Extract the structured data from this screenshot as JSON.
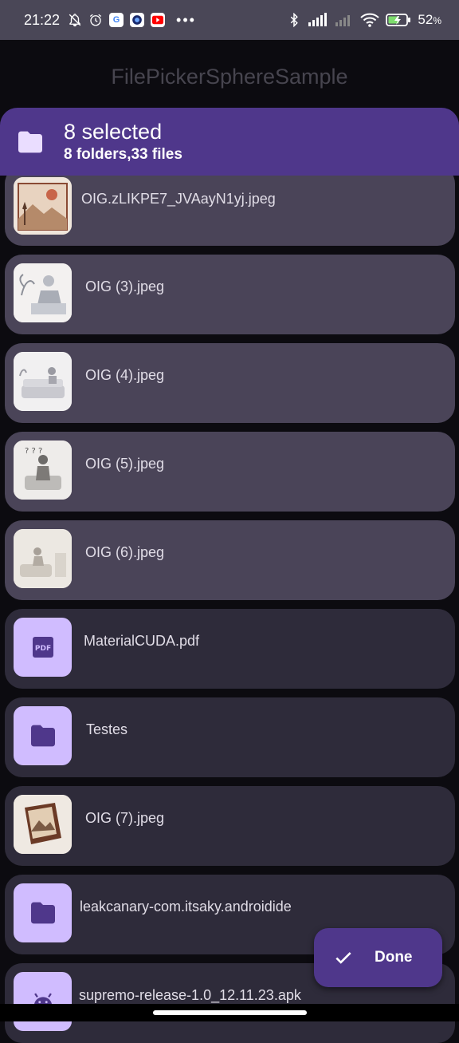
{
  "status_bar": {
    "time": "21:22",
    "battery": "52",
    "battery_unit": "%",
    "overflow": "•••"
  },
  "app": {
    "title": "FilePickerSphereSample"
  },
  "selection": {
    "title": "8 selected",
    "subtitle": "8 folders,33 files"
  },
  "items": [
    {
      "name": "OIG.zLIKPE7_JVAayN1yj.jpeg",
      "selected": true,
      "kind": "image"
    },
    {
      "name": "OIG (3).jpeg",
      "selected": true,
      "kind": "image"
    },
    {
      "name": "OIG (4).jpeg",
      "selected": true,
      "kind": "image"
    },
    {
      "name": "OIG (5).jpeg",
      "selected": true,
      "kind": "image"
    },
    {
      "name": "OIG (6).jpeg",
      "selected": true,
      "kind": "image"
    },
    {
      "name": "MaterialCUDA.pdf",
      "selected": false,
      "kind": "pdf",
      "icon_text": "PDF"
    },
    {
      "name": "Testes",
      "selected": false,
      "kind": "folder"
    },
    {
      "name": "OIG (7).jpeg",
      "selected": false,
      "kind": "image"
    },
    {
      "name": "leakcanary-com.itsaky.androidide",
      "selected": false,
      "kind": "folder"
    },
    {
      "name": "supremo-release-1.0_12.11.23.apk",
      "selected": false,
      "kind": "apk"
    }
  ],
  "fab": {
    "label": "Done",
    "icon": "check-icon"
  },
  "colors": {
    "primary": "#4f378b",
    "selected_card": "#4a4458",
    "card": "#2e2b3a",
    "icon_container": "#d0bcff"
  }
}
